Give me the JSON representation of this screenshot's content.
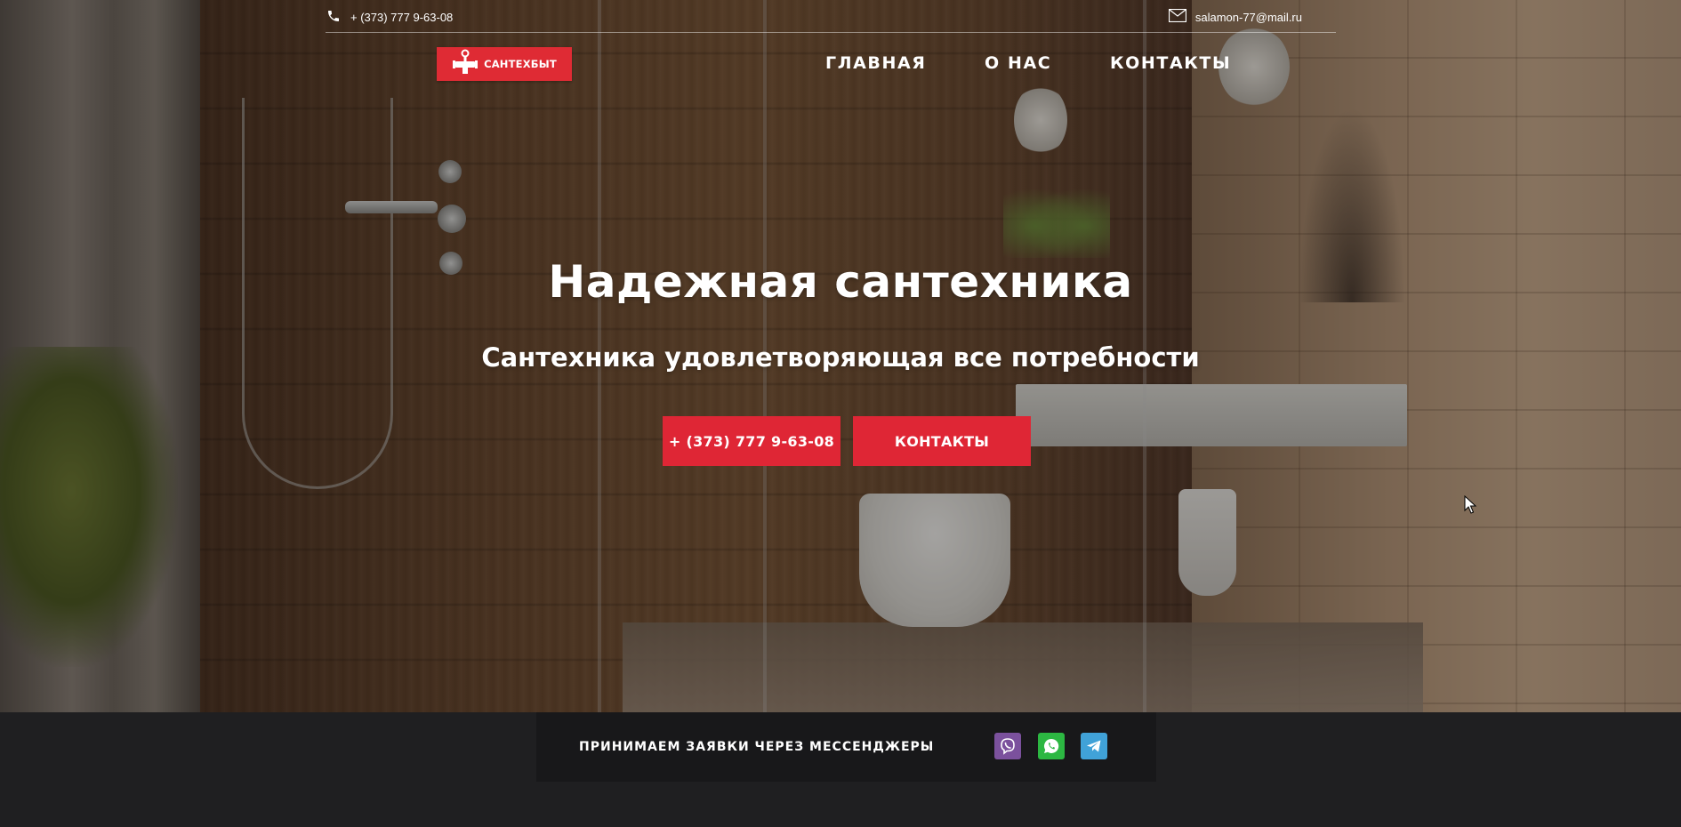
{
  "topbar": {
    "phone": "+ (373) 777 9-63-08",
    "email": "salamon-77@mail.ru"
  },
  "logo": {
    "text": "САНТЕХБЫТ"
  },
  "nav": {
    "items": [
      {
        "label": "ГЛАВНАЯ"
      },
      {
        "label": "О НАС"
      },
      {
        "label": "КОНТАКТЫ"
      }
    ]
  },
  "hero": {
    "title": "Надежная сантехника",
    "subtitle": "Сантехника удовлетворяющая все потребности",
    "phone_button": "+ (373) 777 9-63-08",
    "contacts_button": "КОНТАКТЫ"
  },
  "footer": {
    "messengers_label": "ПРИНИМАЕМ ЗАЯВКИ ЧЕРЕЗ МЕССЕНДЖЕРЫ",
    "icons": [
      "viber-icon",
      "whatsapp-icon",
      "telegram-icon"
    ]
  },
  "colors": {
    "accent": "#df2635",
    "footer_bg": "#1f1f21",
    "viber": "#7b519d",
    "whatsapp": "#2cb742",
    "telegram": "#40a2d8"
  }
}
